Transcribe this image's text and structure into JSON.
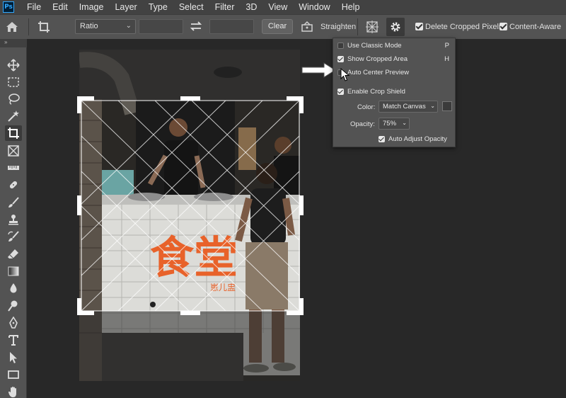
{
  "menu": {
    "logo": "Ps",
    "items": [
      "File",
      "Edit",
      "Image",
      "Layer",
      "Type",
      "Select",
      "Filter",
      "3D",
      "View",
      "Window",
      "Help"
    ]
  },
  "options": {
    "ratio": "Ratio",
    "clear_label": "Clear",
    "straighten_label": "Straighten",
    "delete_cropped_label": "Delete Cropped Pixels",
    "delete_cropped_checked": true,
    "content_aware_label": "Content-Aware",
    "content_aware_checked": true
  },
  "toolbar": {
    "tools": [
      "move-tool",
      "marquee-tool",
      "lasso-tool",
      "magic-wand-tool",
      "crop-tool",
      "frame-tool",
      "ruler-tool",
      "healing-brush-tool",
      "brush-tool",
      "clone-stamp-tool",
      "history-brush-tool",
      "eraser-tool",
      "gradient-tool",
      "blur-tool",
      "dodge-tool",
      "pen-tool",
      "type-tool",
      "path-selection-tool",
      "rectangle-tool",
      "hand-tool"
    ],
    "active": "crop-tool"
  },
  "crop_settings": {
    "use_classic_mode": {
      "label": "Use Classic Mode",
      "checked": false,
      "key": "P"
    },
    "show_cropped_area": {
      "label": "Show Cropped Area",
      "checked": true,
      "key": "H"
    },
    "auto_center_preview": {
      "label": "Auto Center Preview",
      "checked": false
    },
    "enable_crop_shield": {
      "label": "Enable Crop Shield",
      "checked": true
    },
    "color_label": "Color:",
    "color_value": "Match Canvas",
    "opacity_label": "Opacity:",
    "opacity_value": "75%",
    "auto_adjust_opacity": {
      "label": "Auto Adjust Opacity",
      "checked": true
    }
  },
  "photo": {
    "sign_text": "食堂",
    "sign_subtext": "崽儿盅",
    "sign_color": "#e8622a"
  }
}
